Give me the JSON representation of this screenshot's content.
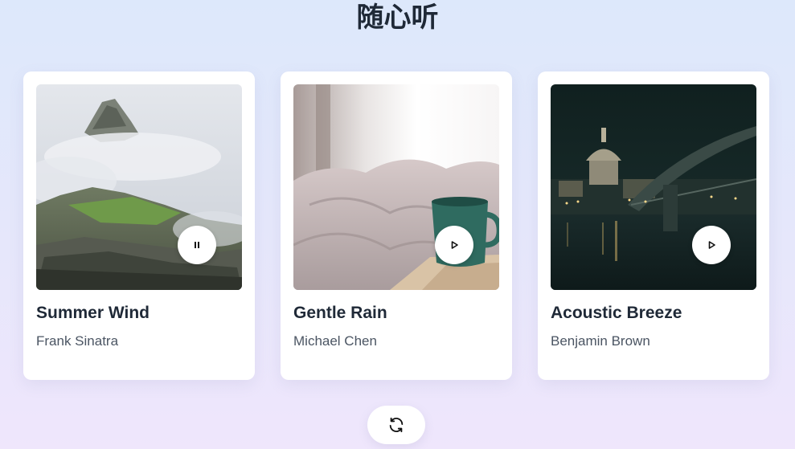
{
  "page": {
    "title": "随心听"
  },
  "songs": [
    {
      "title": "Summer Wind",
      "artist": "Frank Sinatra",
      "cover_icon": "misty-mountain-ruins-image",
      "state": "playing",
      "control_icon": "pause-icon"
    },
    {
      "title": "Gentle Rain",
      "artist": "Michael Chen",
      "cover_icon": "bed-and-mug-image",
      "state": "paused",
      "control_icon": "play-icon"
    },
    {
      "title": "Acoustic Breeze",
      "artist": "Benjamin Brown",
      "cover_icon": "night-city-bridge-image",
      "state": "paused",
      "control_icon": "play-icon"
    }
  ],
  "refresh": {
    "icon": "refresh-icon"
  },
  "colors": {
    "background_top": "#dde8fb",
    "background_bottom": "#efe6fc",
    "card": "#ffffff",
    "title_text": "#1f2937",
    "artist_text": "#4b5563"
  }
}
